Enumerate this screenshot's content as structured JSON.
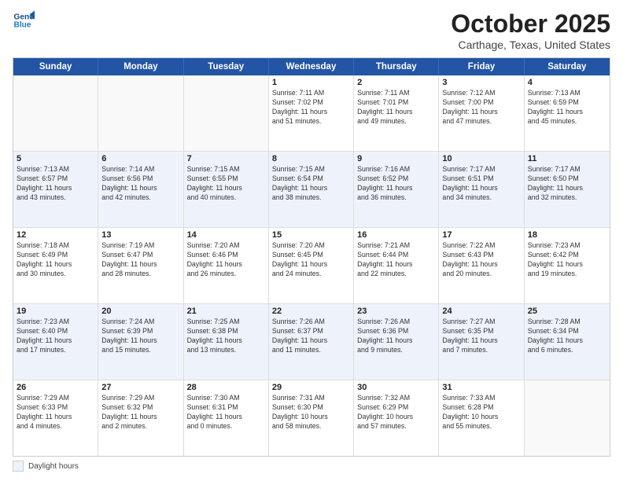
{
  "header": {
    "logo_line1": "General",
    "logo_line2": "Blue",
    "month": "October 2025",
    "location": "Carthage, Texas, United States"
  },
  "day_headers": [
    "Sunday",
    "Monday",
    "Tuesday",
    "Wednesday",
    "Thursday",
    "Friday",
    "Saturday"
  ],
  "weeks": [
    [
      {
        "num": "",
        "info": ""
      },
      {
        "num": "",
        "info": ""
      },
      {
        "num": "",
        "info": ""
      },
      {
        "num": "1",
        "info": "Sunrise: 7:11 AM\nSunset: 7:02 PM\nDaylight: 11 hours\nand 51 minutes."
      },
      {
        "num": "2",
        "info": "Sunrise: 7:11 AM\nSunset: 7:01 PM\nDaylight: 11 hours\nand 49 minutes."
      },
      {
        "num": "3",
        "info": "Sunrise: 7:12 AM\nSunset: 7:00 PM\nDaylight: 11 hours\nand 47 minutes."
      },
      {
        "num": "4",
        "info": "Sunrise: 7:13 AM\nSunset: 6:59 PM\nDaylight: 11 hours\nand 45 minutes."
      }
    ],
    [
      {
        "num": "5",
        "info": "Sunrise: 7:13 AM\nSunset: 6:57 PM\nDaylight: 11 hours\nand 43 minutes."
      },
      {
        "num": "6",
        "info": "Sunrise: 7:14 AM\nSunset: 6:56 PM\nDaylight: 11 hours\nand 42 minutes."
      },
      {
        "num": "7",
        "info": "Sunrise: 7:15 AM\nSunset: 6:55 PM\nDaylight: 11 hours\nand 40 minutes."
      },
      {
        "num": "8",
        "info": "Sunrise: 7:15 AM\nSunset: 6:54 PM\nDaylight: 11 hours\nand 38 minutes."
      },
      {
        "num": "9",
        "info": "Sunrise: 7:16 AM\nSunset: 6:52 PM\nDaylight: 11 hours\nand 36 minutes."
      },
      {
        "num": "10",
        "info": "Sunrise: 7:17 AM\nSunset: 6:51 PM\nDaylight: 11 hours\nand 34 minutes."
      },
      {
        "num": "11",
        "info": "Sunrise: 7:17 AM\nSunset: 6:50 PM\nDaylight: 11 hours\nand 32 minutes."
      }
    ],
    [
      {
        "num": "12",
        "info": "Sunrise: 7:18 AM\nSunset: 6:49 PM\nDaylight: 11 hours\nand 30 minutes."
      },
      {
        "num": "13",
        "info": "Sunrise: 7:19 AM\nSunset: 6:47 PM\nDaylight: 11 hours\nand 28 minutes."
      },
      {
        "num": "14",
        "info": "Sunrise: 7:20 AM\nSunset: 6:46 PM\nDaylight: 11 hours\nand 26 minutes."
      },
      {
        "num": "15",
        "info": "Sunrise: 7:20 AM\nSunset: 6:45 PM\nDaylight: 11 hours\nand 24 minutes."
      },
      {
        "num": "16",
        "info": "Sunrise: 7:21 AM\nSunset: 6:44 PM\nDaylight: 11 hours\nand 22 minutes."
      },
      {
        "num": "17",
        "info": "Sunrise: 7:22 AM\nSunset: 6:43 PM\nDaylight: 11 hours\nand 20 minutes."
      },
      {
        "num": "18",
        "info": "Sunrise: 7:23 AM\nSunset: 6:42 PM\nDaylight: 11 hours\nand 19 minutes."
      }
    ],
    [
      {
        "num": "19",
        "info": "Sunrise: 7:23 AM\nSunset: 6:40 PM\nDaylight: 11 hours\nand 17 minutes."
      },
      {
        "num": "20",
        "info": "Sunrise: 7:24 AM\nSunset: 6:39 PM\nDaylight: 11 hours\nand 15 minutes."
      },
      {
        "num": "21",
        "info": "Sunrise: 7:25 AM\nSunset: 6:38 PM\nDaylight: 11 hours\nand 13 minutes."
      },
      {
        "num": "22",
        "info": "Sunrise: 7:26 AM\nSunset: 6:37 PM\nDaylight: 11 hours\nand 11 minutes."
      },
      {
        "num": "23",
        "info": "Sunrise: 7:26 AM\nSunset: 6:36 PM\nDaylight: 11 hours\nand 9 minutes."
      },
      {
        "num": "24",
        "info": "Sunrise: 7:27 AM\nSunset: 6:35 PM\nDaylight: 11 hours\nand 7 minutes."
      },
      {
        "num": "25",
        "info": "Sunrise: 7:28 AM\nSunset: 6:34 PM\nDaylight: 11 hours\nand 6 minutes."
      }
    ],
    [
      {
        "num": "26",
        "info": "Sunrise: 7:29 AM\nSunset: 6:33 PM\nDaylight: 11 hours\nand 4 minutes."
      },
      {
        "num": "27",
        "info": "Sunrise: 7:29 AM\nSunset: 6:32 PM\nDaylight: 11 hours\nand 2 minutes."
      },
      {
        "num": "28",
        "info": "Sunrise: 7:30 AM\nSunset: 6:31 PM\nDaylight: 11 hours\nand 0 minutes."
      },
      {
        "num": "29",
        "info": "Sunrise: 7:31 AM\nSunset: 6:30 PM\nDaylight: 10 hours\nand 58 minutes."
      },
      {
        "num": "30",
        "info": "Sunrise: 7:32 AM\nSunset: 6:29 PM\nDaylight: 10 hours\nand 57 minutes."
      },
      {
        "num": "31",
        "info": "Sunrise: 7:33 AM\nSunset: 6:28 PM\nDaylight: 10 hours\nand 55 minutes."
      },
      {
        "num": "",
        "info": ""
      }
    ]
  ],
  "footer": {
    "legend_label": "Daylight hours"
  }
}
